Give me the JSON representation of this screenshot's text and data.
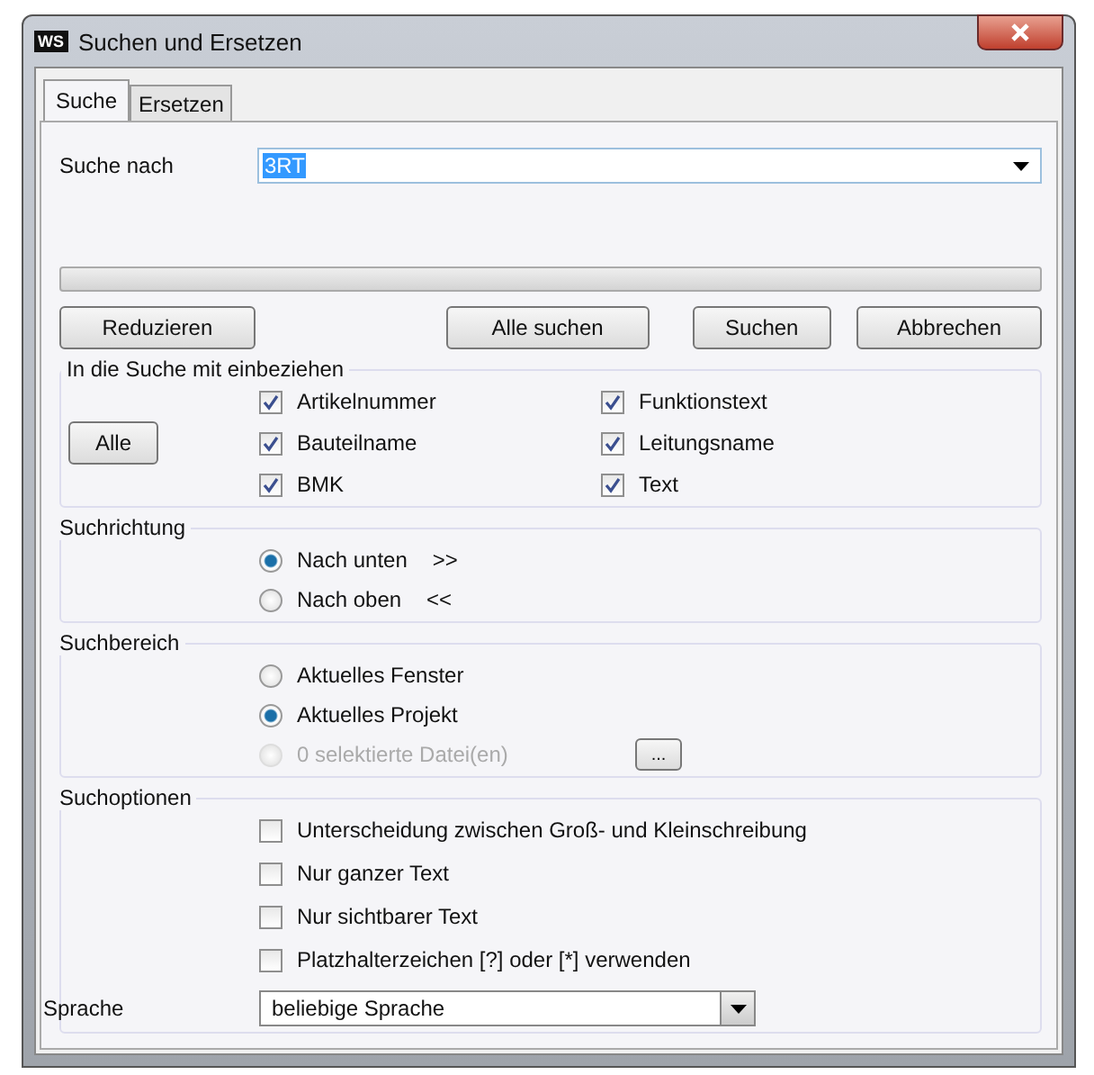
{
  "window": {
    "title": "Suchen und Ersetzen",
    "app_logo": "WS"
  },
  "tabs": [
    {
      "label": "Suche",
      "selected": true
    },
    {
      "label": "Ersetzen",
      "selected": false
    }
  ],
  "search": {
    "label": "Suche nach",
    "value": "3RT"
  },
  "progress": {
    "level": 0
  },
  "buttons": [
    {
      "label": "Reduzieren"
    },
    {
      "label": "Alle suchen"
    },
    {
      "label": "Suchen"
    },
    {
      "label": "Abbrechen"
    }
  ],
  "include": {
    "title": "In die Suche mit einbeziehen",
    "all_button": "Alle",
    "items": [
      {
        "label": "Artikelnummer",
        "checked": true
      },
      {
        "label": "Funktionstext",
        "checked": true
      },
      {
        "label": "Bauteilname",
        "checked": true
      },
      {
        "label": "Leitungsname",
        "checked": true
      },
      {
        "label": "BMK",
        "checked": true
      },
      {
        "label": "Text",
        "checked": true
      }
    ]
  },
  "direction": {
    "title": "Suchrichtung",
    "options": [
      {
        "label": "Nach unten",
        "suffix": ">>",
        "selected": true
      },
      {
        "label": "Nach oben",
        "suffix": "<<",
        "selected": false
      }
    ]
  },
  "scope": {
    "title": "Suchbereich",
    "options": [
      {
        "label": "Aktuelles Fenster",
        "selected": false,
        "disabled": false
      },
      {
        "label": "Aktuelles Projekt",
        "selected": true,
        "disabled": false
      },
      {
        "label": "0 selektierte Datei(en)",
        "selected": false,
        "disabled": true,
        "browse": "..."
      }
    ]
  },
  "options": {
    "title": "Suchoptionen",
    "items": [
      {
        "label": "Unterscheidung zwischen Groß- und Kleinschreibung",
        "checked": false
      },
      {
        "label": "Nur ganzer Text",
        "checked": false
      },
      {
        "label": "Nur sichtbarer Text",
        "checked": false
      },
      {
        "label": "Platzhalterzeichen [?] oder [*] verwenden",
        "checked": false
      }
    ]
  },
  "language": {
    "label": "Sprache",
    "value": "beliebige Sprache"
  }
}
